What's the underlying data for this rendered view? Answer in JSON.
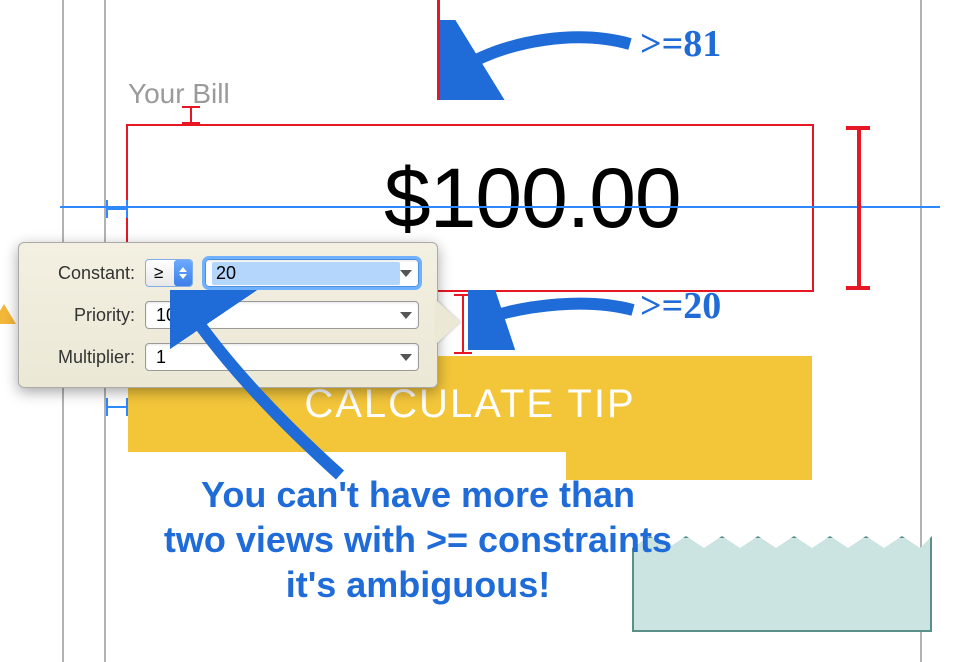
{
  "label": "Your Bill",
  "bill_value": "$100.00",
  "button_label": "CALCULATE TIP",
  "popover": {
    "constant_label": "Constant:",
    "relation": "≥",
    "constant_value": "20",
    "priority_label": "Priority:",
    "priority_value": "10",
    "multiplier_label": "Multiplier:",
    "multiplier_value": "1"
  },
  "annotations": {
    "ge81": ">=81",
    "ge20": ">=20",
    "body_l1": "You can't have more than",
    "body_l2": "two views with >= constraints",
    "body_l3": "it's ambiguous!"
  }
}
